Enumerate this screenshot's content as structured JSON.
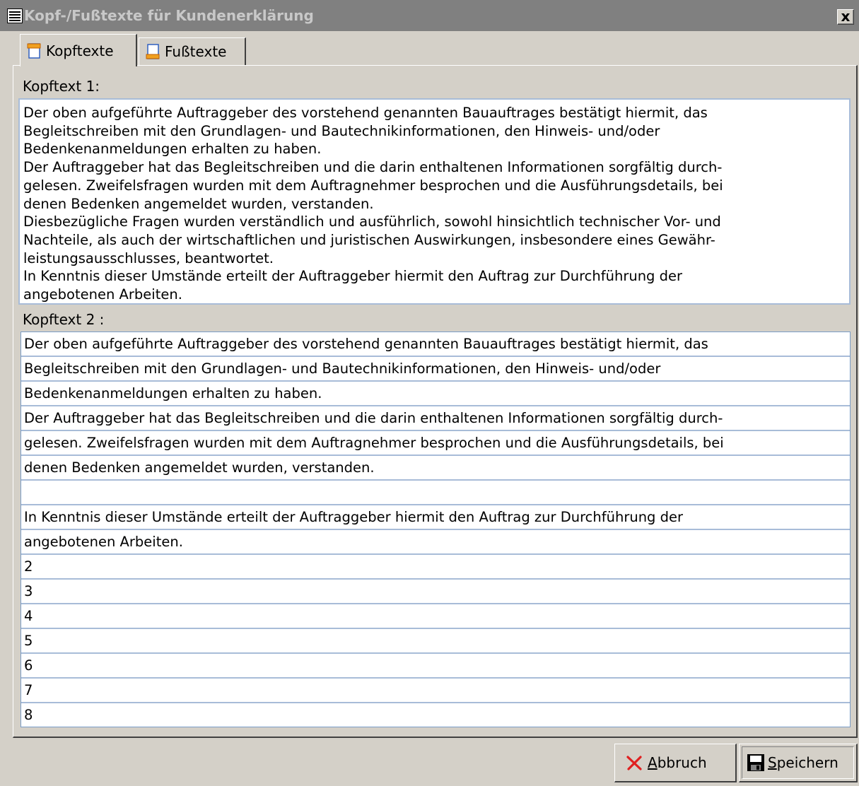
{
  "window": {
    "title": "Kopf-/Fußtexte für Kundenerklärung",
    "close_label": "x"
  },
  "tabs": [
    {
      "label": "Kopftexte",
      "icon": "header-page-icon",
      "active": true
    },
    {
      "label": "Fußtexte",
      "icon": "footer-page-icon",
      "active": false
    }
  ],
  "kopftext1": {
    "label": "Kopftext 1:",
    "lines": [
      "Der oben aufgeführte Auftraggeber des vorstehend genannten Bauauftrages bestätigt hiermit, das",
      "Begleitschreiben mit den Grundlagen- und Bautechnikinformationen, den Hinweis- und/oder",
      "Bedenkenanmeldungen erhalten zu haben.",
      "Der Auftraggeber hat das Begleitschreiben und die darin enthaltenen Informationen sorgfältig durch-",
      "gelesen. Zweifelsfragen wurden mit dem Auftragnehmer besprochen und die Ausführungsdetails, bei",
      "denen Bedenken angemeldet wurden, verstanden.",
      "Diesbezügliche Fragen wurden verständlich und ausführlich, sowohl hinsichtlich technischer Vor- und",
      "Nachteile, als auch der wirtschaftlichen und juristischen Auswirkungen, insbesondere eines Gewähr-",
      "leistungsausschlusses, beantwortet.",
      "In Kenntnis dieser Umstände erteilt der Auftraggeber hiermit den Auftrag zur Durchführung der",
      "angebotenen Arbeiten."
    ]
  },
  "kopftext2": {
    "label": "Kopftext 2 :",
    "rows": [
      "Der oben aufgeführte Auftraggeber des vorstehend genannten Bauauftrages bestätigt hiermit, das",
      "Begleitschreiben mit den Grundlagen- und Bautechnikinformationen, den Hinweis- und/oder",
      "Bedenkenanmeldungen erhalten zu haben.",
      "Der Auftraggeber hat das Begleitschreiben und die darin enthaltenen Informationen sorgfältig durch-",
      "gelesen. Zweifelsfragen wurden mit dem Auftragnehmer besprochen und die Ausführungsdetails, bei",
      "denen Bedenken angemeldet wurden, verstanden.",
      "",
      "In Kenntnis dieser Umstände erteilt der Auftraggeber hiermit den Auftrag zur Durchführung der",
      "angebotenen Arbeiten.",
      "2",
      "3",
      "4",
      "5",
      "6",
      "7",
      "8"
    ]
  },
  "buttons": {
    "cancel": {
      "mnemonic": "A",
      "rest": "bbruch",
      "icon": "cancel-x-icon",
      "icon_color": "#e02020"
    },
    "save": {
      "mnemonic": "S",
      "rest": "peichern",
      "icon": "floppy-disk-icon"
    }
  }
}
